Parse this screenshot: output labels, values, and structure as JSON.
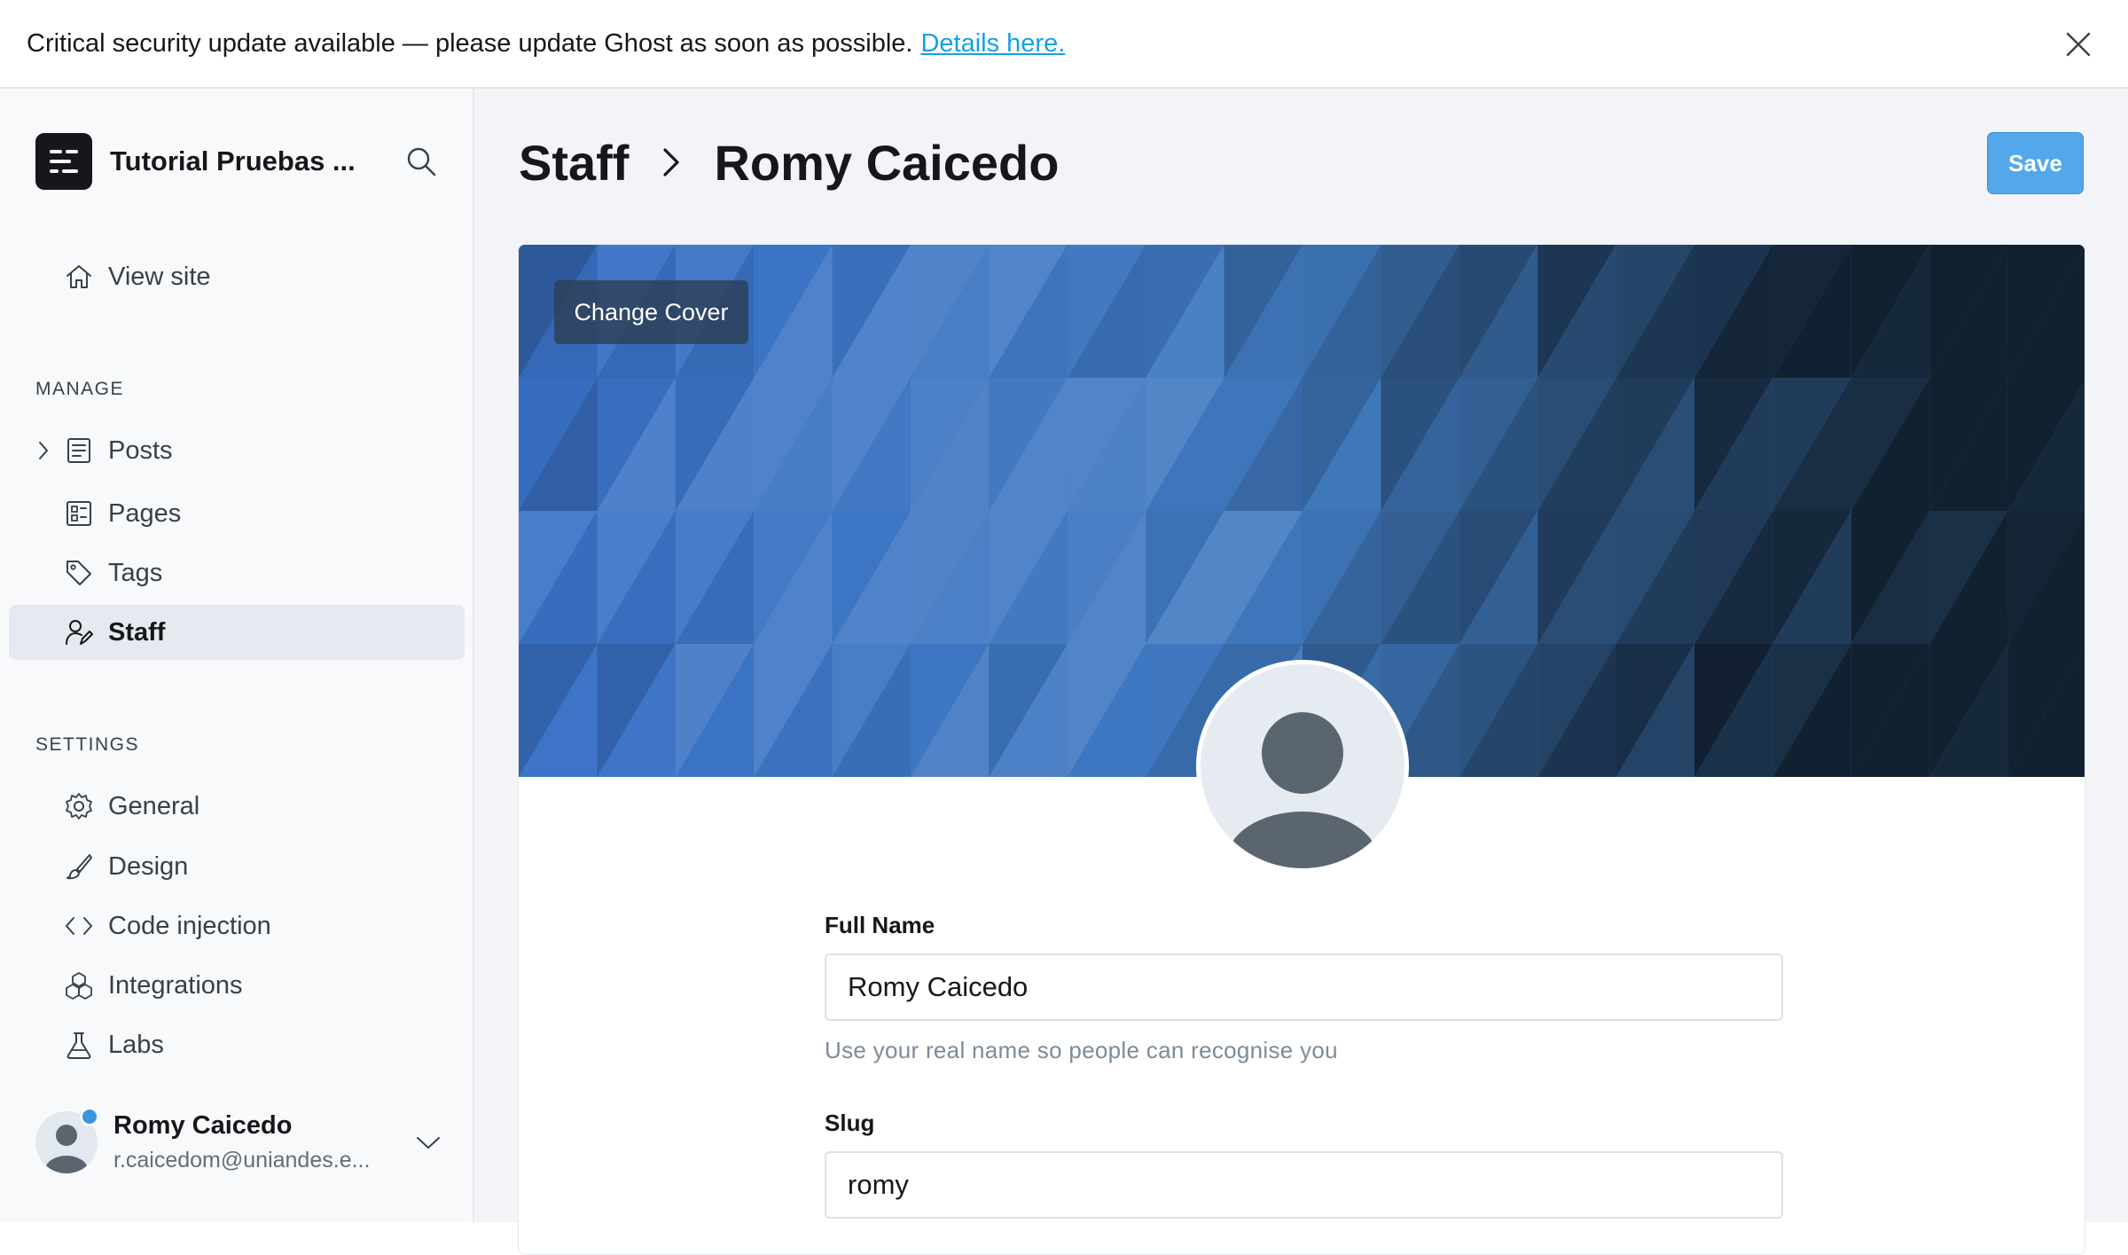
{
  "banner": {
    "message": "Critical security update available — please update Ghost as soon as possible.",
    "link_text": "Details here."
  },
  "sidebar": {
    "site_title": "Tutorial Pruebas ...",
    "view_site": "View site",
    "manage_heading": "MANAGE",
    "settings_heading": "SETTINGS",
    "manage_items": [
      {
        "label": "Posts",
        "icon": "posts-icon"
      },
      {
        "label": "Pages",
        "icon": "pages-icon"
      },
      {
        "label": "Tags",
        "icon": "tag-icon"
      },
      {
        "label": "Staff",
        "icon": "staff-icon",
        "active": true
      }
    ],
    "settings_items": [
      {
        "label": "General",
        "icon": "gear-icon"
      },
      {
        "label": "Design",
        "icon": "brush-icon"
      },
      {
        "label": "Code injection",
        "icon": "code-icon"
      },
      {
        "label": "Integrations",
        "icon": "integrations-icon"
      },
      {
        "label": "Labs",
        "icon": "flask-icon"
      }
    ],
    "user": {
      "name": "Romy Caicedo",
      "email": "r.caicedom@uniandes.e..."
    }
  },
  "header": {
    "breadcrumb_parent": "Staff",
    "breadcrumb_current": "Romy Caicedo",
    "save_label": "Save"
  },
  "profile": {
    "change_cover_label": "Change Cover",
    "full_name_label": "Full Name",
    "full_name_value": "Romy Caicedo",
    "full_name_hint": "Use your real name so people can recognise you",
    "slug_label": "Slug",
    "slug_value": "romy"
  },
  "colors": {
    "accent": "#14a1e4",
    "save_button": "#52a8ea",
    "sidebar_bg": "#f8f9fa",
    "main_bg": "#f2f4f7",
    "online_dot": "#3a95e3"
  }
}
